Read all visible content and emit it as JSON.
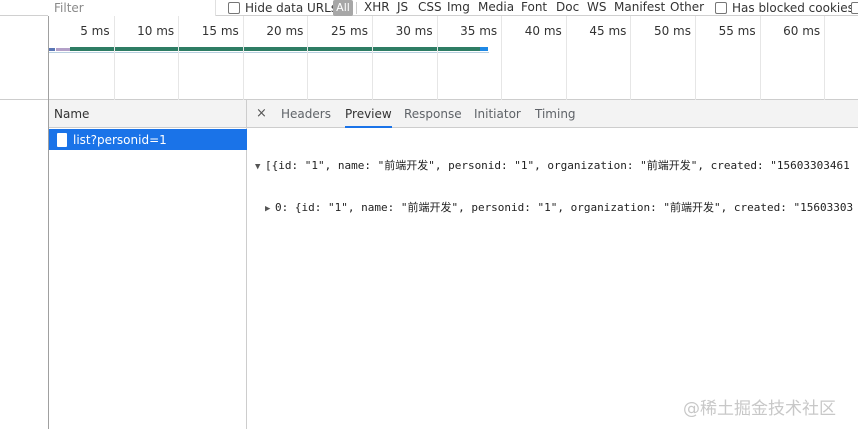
{
  "filter": {
    "placeholder": "Filter",
    "hide_data_urls": "Hide data URLs",
    "types": [
      "All",
      "XHR",
      "JS",
      "CSS",
      "Img",
      "Media",
      "Font",
      "Doc",
      "WS",
      "Manifest",
      "Other"
    ],
    "has_blocked_cookies": "Has blocked cookies"
  },
  "timeline": {
    "ticks": [
      "5 ms",
      "10 ms",
      "15 ms",
      "20 ms",
      "25 ms",
      "30 ms",
      "35 ms",
      "40 ms",
      "45 ms",
      "50 ms",
      "55 ms",
      "60 ms"
    ],
    "request_end_ms": 34,
    "colors": {
      "waiting": "#2e7d64",
      "download": "#1e88e5",
      "queueing": "#b3a0c8"
    }
  },
  "requests": {
    "header": "Name",
    "items": [
      {
        "name": "list?personid=1",
        "selected": true
      }
    ]
  },
  "details": {
    "close": "×",
    "tabs": [
      "Headers",
      "Preview",
      "Response",
      "Initiator",
      "Timing"
    ],
    "active_tab": "Preview",
    "preview": {
      "line1": "[{id: \"1\", name: \"前端开发\", personid: \"1\", organization: \"前端开发\", created: \"15603303461",
      "line2": "0: {id: \"1\", name: \"前端开发\", personid: \"1\", organization: \"前端开发\", created: \"15603303"
    }
  },
  "watermark": "@稀土掘金技术社区",
  "colors": {
    "accent": "#1a73e8",
    "selected_row": "#1a73e8"
  }
}
